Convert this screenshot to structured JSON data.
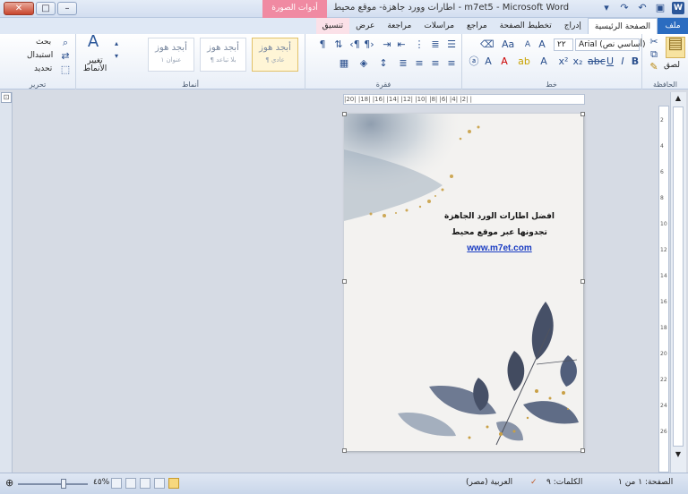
{
  "window": {
    "title": "اطارات وورد جاهزة- موقع محيط - m7et5 - Microsoft Word",
    "context_tab_group": "أدوات الصورة",
    "controls": {
      "close": "✕",
      "maximize": "□",
      "minimize": "–"
    }
  },
  "tabs": [
    {
      "label": "ملف",
      "state": "file"
    },
    {
      "label": "الصفحة الرئيسية",
      "state": "active"
    },
    {
      "label": "إدراج",
      "state": ""
    },
    {
      "label": "تخطيط الصفحة",
      "state": ""
    },
    {
      "label": "مراجع",
      "state": ""
    },
    {
      "label": "مراسلات",
      "state": ""
    },
    {
      "label": "مراجعة",
      "state": ""
    },
    {
      "label": "عرض",
      "state": ""
    },
    {
      "label": "تنسيق",
      "state": "ctx"
    }
  ],
  "ribbon": {
    "clipboard": {
      "paste": "لصق",
      "label": "الحافظة"
    },
    "font": {
      "name": "Arial (أساسي نص)",
      "size": "٢٢",
      "label": "خط"
    },
    "paragraph": {
      "label": "فقرة"
    },
    "styles": {
      "items": [
        {
          "sample": "أبجد هوز",
          "name": "¶ عادي",
          "selected": true
        },
        {
          "sample": "أبجد هوز",
          "name": "¶ بلا تباعد",
          "selected": false
        },
        {
          "sample": "أبجد هوز",
          "name": "عنوان ١",
          "selected": false
        }
      ],
      "change_styles": "تغيير الأنماط",
      "label": "أنماط"
    },
    "editing": {
      "find": "بحث",
      "replace": "استبدال",
      "select": "تحديد",
      "label": "تحرير"
    }
  },
  "ruler": {
    "marks": "|20| |18| |16| |14| |12| |10| |8| |6| |4| |2| |"
  },
  "document": {
    "line1": "افضل اطارات الورد الجاهزة",
    "line2": "تجدونها عبر موقع محيط",
    "link": "www.m7et.com",
    "accent": "#1a3cc2"
  },
  "status": {
    "page": "الصفحة: ١ من ١",
    "words": "الكلمات: ٩",
    "language": "العربية (مصر)",
    "zoom": "٤٥%"
  },
  "colors": {
    "file_tab": "#2b6cc0",
    "context": "#f08aa2",
    "ribbon_bg": "#e8eef7"
  }
}
